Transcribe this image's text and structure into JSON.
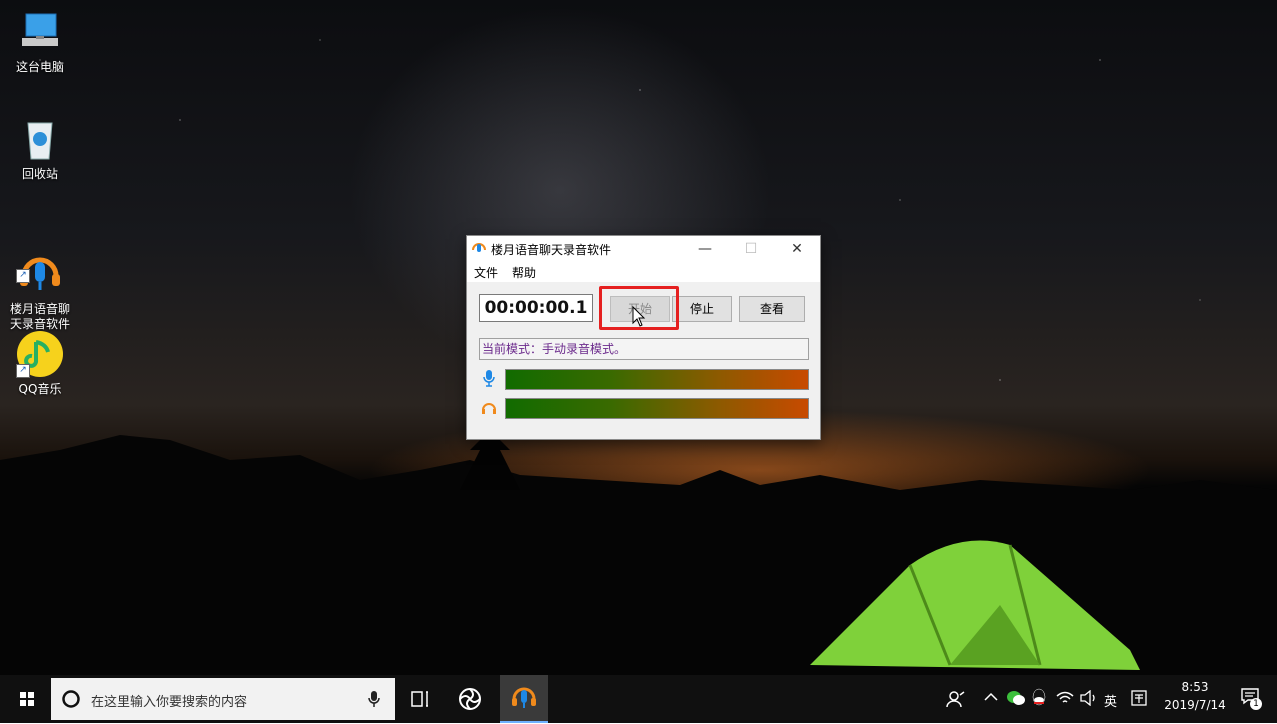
{
  "desktop": {
    "icons": [
      {
        "label": "这台电脑",
        "icon": "computer-icon"
      },
      {
        "label": "回收站",
        "icon": "recycle-bin-icon"
      },
      {
        "label": "楼月语音聊\n天录音软件",
        "icon": "headset-mic-icon"
      },
      {
        "label": "QQ音乐",
        "icon": "qq-music-icon"
      }
    ]
  },
  "app_window": {
    "title": "楼月语音聊天录音软件",
    "controls": {
      "minimize": "—",
      "maximize": "☐",
      "close": "✕"
    },
    "menu": [
      "文件",
      "帮助"
    ],
    "timer": "00:00:00.1",
    "buttons": {
      "start": "开始",
      "stop": "停止",
      "view": "查看"
    },
    "start_enabled": false,
    "status": "当前模式：手动录音模式。",
    "meters": [
      {
        "name": "microphone",
        "icon": "microphone-icon",
        "color": "#1e88e5"
      },
      {
        "name": "headphones",
        "icon": "headphones-icon",
        "color": "#f08a1c"
      }
    ],
    "highlight_color": "#e52020"
  },
  "taskbar": {
    "search_placeholder": "在这里输入你要搜索的内容",
    "tray": {
      "ime": "英",
      "time": "8:53",
      "date": "2019/7/14",
      "notification_count": "1"
    }
  }
}
